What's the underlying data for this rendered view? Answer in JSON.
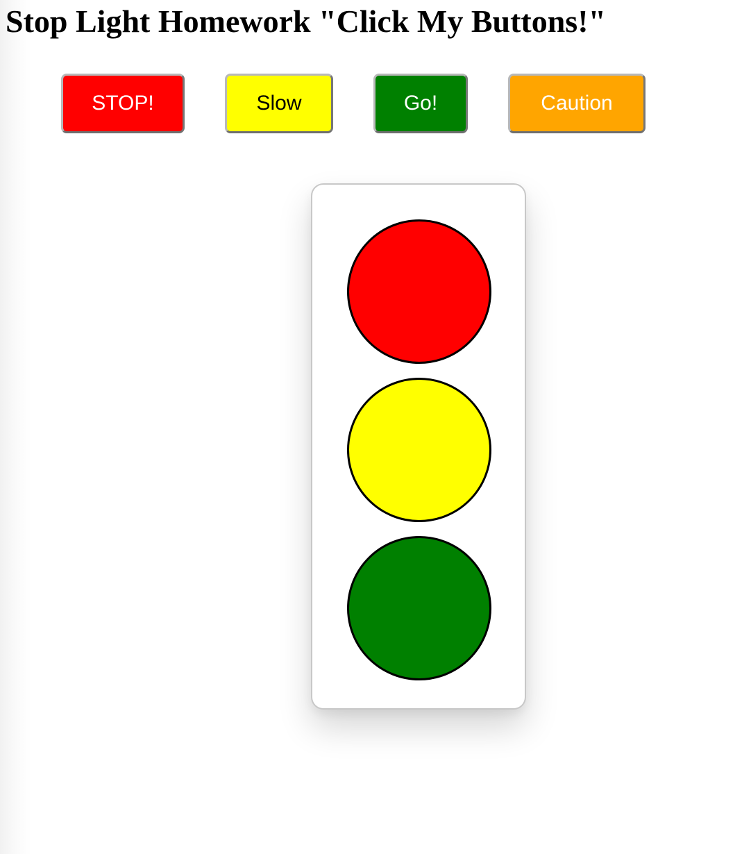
{
  "page": {
    "title": "Stop Light Homework \"Click My Buttons!\""
  },
  "buttons": {
    "stop": {
      "label": "STOP!",
      "color": "#ff0000",
      "text_color": "#ffffff"
    },
    "slow": {
      "label": "Slow",
      "color": "#ffff00",
      "text_color": "#000000"
    },
    "go": {
      "label": "Go!",
      "color": "#008000",
      "text_color": "#ffffff"
    },
    "caution": {
      "label": "Caution",
      "color": "#ffa500",
      "text_color": "#ffffff"
    }
  },
  "traffic_light": {
    "lamps": [
      {
        "name": "red",
        "color": "#ff0000"
      },
      {
        "name": "yellow",
        "color": "#ffff00"
      },
      {
        "name": "green",
        "color": "#008000"
      }
    ]
  }
}
